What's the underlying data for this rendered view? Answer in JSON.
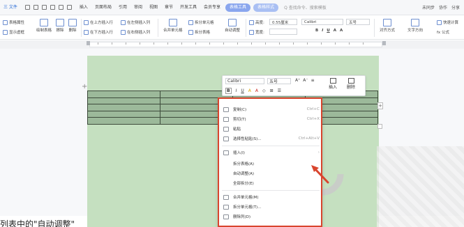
{
  "menubar": {
    "file": "三 文件",
    "tabs": [
      "插入",
      "页面布局",
      "引用",
      "审阅",
      "视图",
      "章节",
      "开发工具",
      "会员专享"
    ],
    "active_pills": [
      "表格工具",
      "表格样式"
    ],
    "search": "Q 查找命令、搜索模板",
    "right": [
      "未同步",
      "协作",
      "分享"
    ]
  },
  "ribbon": {
    "table_props": "表格属性",
    "show_gridlines": "显示虚框",
    "draw_table": "绘制表格",
    "erase": "擦除",
    "delete": "删除",
    "insert_above": "在上方插入行",
    "insert_below": "在下方插入行",
    "insert_left": "在左侧插入列",
    "insert_right": "在右侧插入列",
    "merge": "合并单元格",
    "split_cells": "拆分单元格",
    "split_table": "拆分表格",
    "auto_fit": "自动调整",
    "height_label": "高度:",
    "height_value": "0.55厘米",
    "width_label": "宽度:",
    "font_name": "Calibri",
    "font_size": "五号",
    "align": "对齐方式",
    "text_dir": "文字方向",
    "quick_calc": "快速计算",
    "formula": "fx 公式"
  },
  "floatbar": {
    "font": "Calibri",
    "size": "五号",
    "insert": "插入",
    "delete": "删除"
  },
  "context_menu": {
    "copy": "复制(C)",
    "copy_sc": "Ctrl+C",
    "cut": "剪切(T)",
    "cut_sc": "Ctrl+X",
    "paste": "粘贴",
    "paste_special": "选择性粘贴(S)...",
    "paste_special_sc": "Ctrl+Alt+V",
    "insert": "插入(I)",
    "distribute_rows": "拆分表格(A)",
    "auto_adjust": "自动调整(A)",
    "equal_all": "全部拆分(E)",
    "merge": "合并单元格(M)",
    "split_cells": "拆分单元格(T)...",
    "delete_col": "删除列(D)"
  },
  "caption": "列表中的\"自动调整\""
}
